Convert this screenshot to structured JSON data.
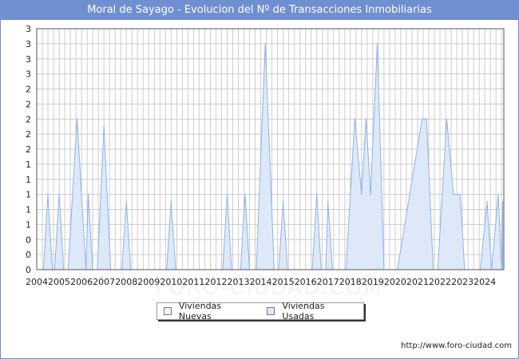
{
  "title": "Moral de Sayago - Evolucion del Nº de Transacciones Inmobiliarias",
  "source": "http://www.foro-ciudad.com",
  "watermark": "FORO-CIUDAD.COM",
  "colors": {
    "titlebar": "#6f8fd0",
    "usadas_fill": "#dde9f8",
    "usadas_line": "#8fb2e6",
    "nuevas_fill": "#f2f2f2",
    "grid": "#cccccc"
  },
  "chart_data": {
    "type": "area",
    "title": "Moral de Sayago - Evolucion del Nº de Transacciones Inmobiliarias",
    "xlabel": "",
    "ylabel": "",
    "x_tick_labels": [
      "2004",
      "2005",
      "2006",
      "2007",
      "2008",
      "2009",
      "2010",
      "2011",
      "2012",
      "2013",
      "2014",
      "2015",
      "2016",
      "2017",
      "2018",
      "2019",
      "2020",
      "2021",
      "2022",
      "2023",
      "2024"
    ],
    "y_tick_labels": [
      "0",
      "0",
      "0",
      "1",
      "1",
      "1",
      "1",
      "1",
      "2",
      "2",
      "2",
      "2",
      "2",
      "3",
      "3",
      "3",
      "3"
    ],
    "ylim": [
      0,
      3.2
    ],
    "grid": true,
    "legend_position": "bottom",
    "series": [
      {
        "name": "Viviendas Nuevas",
        "values": []
      },
      {
        "name": "Viviendas Usadas",
        "x": [
          2004.3,
          2004.5,
          2004.7,
          2004.8,
          2005.0,
          2005.2,
          2005.4,
          2005.8,
          2006.2,
          2006.3,
          2006.5,
          2006.7,
          2007.0,
          2007.3,
          2007.5,
          2007.8,
          2008.0,
          2008.2,
          2009.8,
          2010.0,
          2010.2,
          2012.3,
          2012.5,
          2012.7,
          2013.1,
          2013.3,
          2013.5,
          2013.8,
          2014.2,
          2014.6,
          2014.8,
          2015.0,
          2015.2,
          2016.3,
          2016.5,
          2016.7,
          2016.9,
          2017.0,
          2017.2,
          2017.8,
          2018.2,
          2018.5,
          2018.7,
          2018.9,
          2019.2,
          2019.5,
          2019.8,
          2020.1,
          2021.2,
          2021.4,
          2021.7,
          2021.9,
          2022.3,
          2022.6,
          2022.9,
          2023.1,
          2023.3,
          2023.8,
          2024.1,
          2024.3,
          2024.6,
          2024.75,
          2024.8
        ],
        "values": [
          0,
          1,
          0,
          0,
          1,
          0,
          0,
          2,
          0,
          1,
          0,
          0,
          1.9,
          0,
          0,
          0,
          0.9,
          0,
          0,
          0.9,
          0,
          0,
          1,
          0,
          0,
          1,
          0,
          0,
          3,
          0,
          0,
          0.9,
          0,
          0,
          1,
          0,
          0,
          0.9,
          0,
          0,
          2,
          1.0,
          2,
          1.0,
          3,
          0,
          0,
          0,
          2,
          2,
          0,
          0,
          2,
          1,
          1,
          0,
          0,
          0,
          0.9,
          0,
          1,
          0,
          0.9
        ]
      }
    ]
  },
  "legend": {
    "nuevas": "Viviendas Nuevas",
    "usadas": "Viviendas Usadas"
  }
}
